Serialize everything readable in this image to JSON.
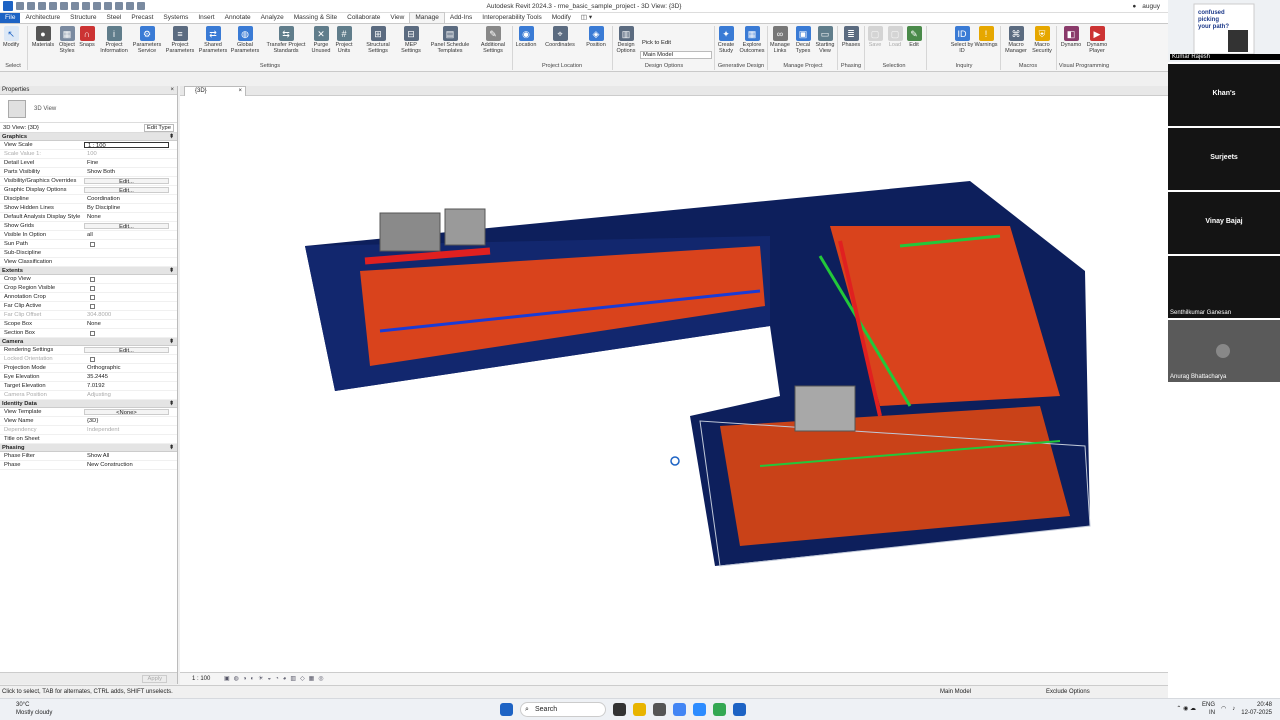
{
  "titlebar": {
    "title": "Autodesk Revit 2024.3 - rme_basic_sample_project - 3D View: {3D}",
    "user": "auguy"
  },
  "tabs": [
    "File",
    "Architecture",
    "Structure",
    "Steel",
    "Precast",
    "Systems",
    "Insert",
    "Annotate",
    "Analyze",
    "Massing & Site",
    "Collaborate",
    "View",
    "Manage",
    "Add-Ins",
    "Interoperability Tools",
    "Modify"
  ],
  "ribbon": {
    "buttons": [
      "Modify",
      "Materials",
      "Object Styles",
      "Snaps",
      "Project Information",
      "Parameters Service",
      "Project Parameters",
      "Shared Parameters",
      "Global Parameters",
      "Transfer Project Standards",
      "Purge Unused",
      "Project Units",
      "Structural Settings",
      "MEP Settings",
      "Panel Schedule Templates",
      "Additional Settings",
      "Location",
      "Coordinates",
      "Position",
      "Design Options",
      "Pick to Edit",
      "Main Model",
      "Create Study",
      "Explore Outcomes",
      "Manage Links",
      "Decal Types",
      "Starting View",
      "Phases",
      "Save",
      "Load",
      "Edit",
      "Select by ID",
      "Warnings",
      "Macro Manager",
      "Macro Security",
      "Dynamo",
      "Dynamo Player"
    ],
    "panels": [
      "Select",
      "Settings",
      "Project Location",
      "Design Options",
      "Generative Design",
      "Manage Project",
      "Phasing",
      "Selection",
      "Inquiry",
      "Macros",
      "Visual Programming"
    ]
  },
  "properties": {
    "header": "Properties",
    "type_name": "3D View",
    "instance": "3D View: {3D}",
    "edit_type": "Edit Type",
    "sections": [
      {
        "name": "Graphics",
        "rows": [
          [
            "View Scale",
            "1 : 100"
          ],
          [
            "Scale Value 1:",
            "100"
          ],
          [
            "Detail Level",
            "Fine"
          ],
          [
            "Parts Visibility",
            "Show Both"
          ],
          [
            "Visibility/Graphics Overrides",
            "Edit..."
          ],
          [
            "Graphic Display Options",
            "Edit..."
          ],
          [
            "Discipline",
            "Coordination"
          ],
          [
            "Show Hidden Lines",
            "By Discipline"
          ],
          [
            "Default Analysis Display Style",
            "None"
          ],
          [
            "Show Grids",
            "Edit..."
          ],
          [
            "Visible In Option",
            "all"
          ],
          [
            "Sun Path",
            ""
          ],
          [
            "Sub-Discipline",
            ""
          ],
          [
            "View Classification",
            ""
          ]
        ]
      },
      {
        "name": "Extents",
        "rows": [
          [
            "Crop View",
            ""
          ],
          [
            "Crop Region Visible",
            ""
          ],
          [
            "Annotation Crop",
            ""
          ],
          [
            "Far Clip Active",
            ""
          ],
          [
            "Far Clip Offset",
            "304.8000"
          ],
          [
            "Scope Box",
            "None"
          ],
          [
            "Section Box",
            ""
          ]
        ]
      },
      {
        "name": "Camera",
        "rows": [
          [
            "Rendering Settings",
            "Edit..."
          ],
          [
            "Locked Orientation",
            ""
          ],
          [
            "Projection Mode",
            "Orthographic"
          ],
          [
            "Eye Elevation",
            "35.2445"
          ],
          [
            "Target Elevation",
            "7.0192"
          ],
          [
            "Camera Position",
            "Adjusting"
          ]
        ]
      },
      {
        "name": "Identity Data",
        "rows": [
          [
            "View Template",
            "<None>"
          ],
          [
            "View Name",
            "{3D}"
          ],
          [
            "Dependency",
            "Independent"
          ],
          [
            "Title on Sheet",
            ""
          ]
        ]
      },
      {
        "name": "Phasing",
        "rows": [
          [
            "Phase Filter",
            "Show All"
          ],
          [
            "Phase",
            "New Construction"
          ]
        ]
      }
    ],
    "apply": "Apply"
  },
  "view_tab": "{3D}",
  "view_control": {
    "scale": "1 : 100"
  },
  "status": {
    "hint": "Click to select, TAB for alternates, CTRL adds, SHIFT unselects.",
    "model": "Main Model",
    "exclude": "Exclude Options"
  },
  "taskbar": {
    "temp": "30°C",
    "weather": "Mostly cloudy",
    "search": "Search",
    "lang": "ENG",
    "region": "IN",
    "time": "20:48",
    "date": "12-07-2025"
  },
  "participants": [
    "Kumar Rajesh",
    "Khan's",
    "Surjeets",
    "Vinay Bajaj",
    "Senthilkumar Ganesan",
    "Anurag Bhattacharya"
  ],
  "colors": {
    "accent": "#1d63c4",
    "duct_red": "#e0451f",
    "pipe_green": "#22c83a",
    "structure_blue": "#0d1f5c"
  }
}
